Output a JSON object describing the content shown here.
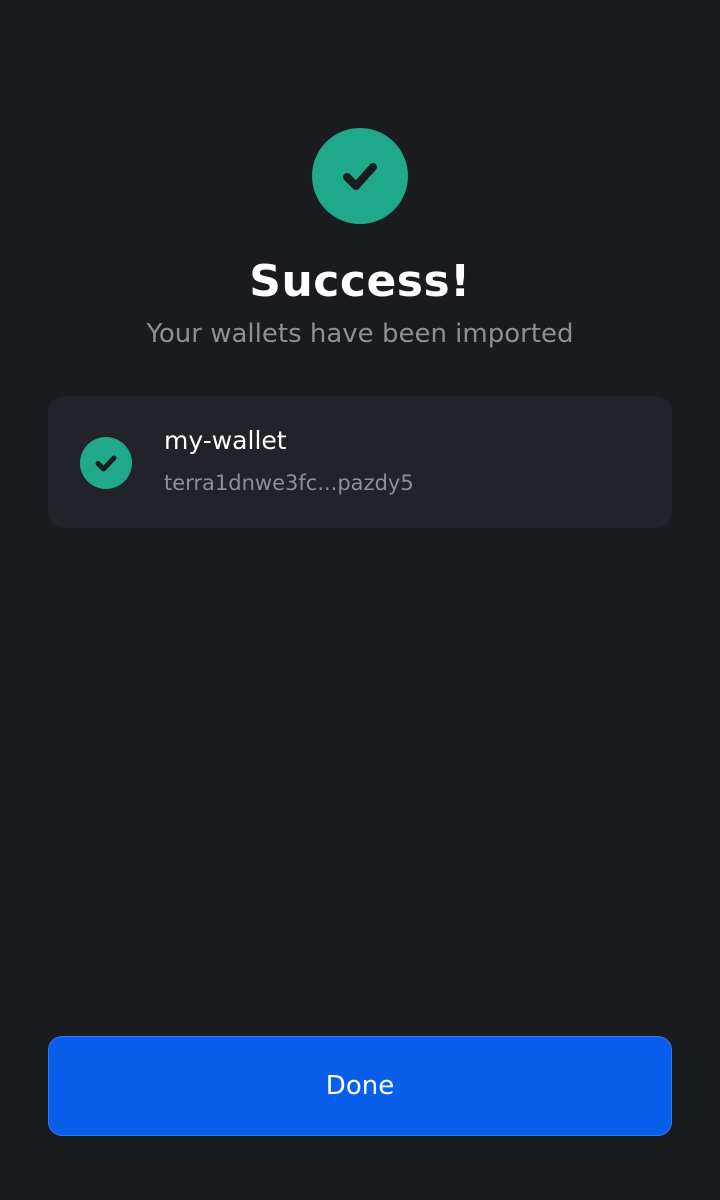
{
  "header": {
    "status_icon": "check-icon",
    "title": "Success!",
    "subtitle": "Your wallets have been imported"
  },
  "wallets": [
    {
      "icon": "check-icon",
      "name": "my-wallet",
      "address": "terra1dnwe3fc...pazdy5"
    }
  ],
  "footer": {
    "done_label": "Done"
  },
  "colors": {
    "background": "#1a1b1f",
    "card": "#222328",
    "success": "#1fa98a",
    "primary": "#095fec",
    "muted_text": "#8d8e97"
  }
}
